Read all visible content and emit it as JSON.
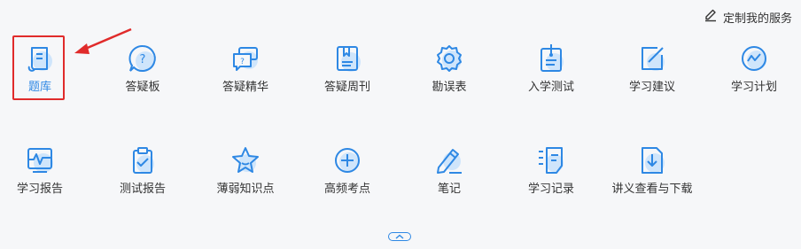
{
  "header": {
    "customize_label": "定制我的服务",
    "customize_icon": "pencil-icon"
  },
  "accent_color": "#2e88e4",
  "highlight_color": "#e02b2b",
  "row1": [
    {
      "label": "题库",
      "icon": "question-bank-icon",
      "active": true
    },
    {
      "label": "答疑板",
      "icon": "question-bubble-icon"
    },
    {
      "label": "答疑精华",
      "icon": "chat-bubbles-icon"
    },
    {
      "label": "答疑周刊",
      "icon": "bookmark-book-icon"
    },
    {
      "label": "勘误表",
      "icon": "gear-icon"
    },
    {
      "label": "入学测试",
      "icon": "clipboard-pin-icon"
    },
    {
      "label": "学习建议",
      "icon": "edit-square-icon"
    },
    {
      "label": "学习计划",
      "icon": "trend-circle-icon"
    }
  ],
  "row2": [
    {
      "label": "学习报告",
      "icon": "pulse-chart-icon"
    },
    {
      "label": "测试报告",
      "icon": "clipboard-check-icon"
    },
    {
      "label": "薄弱知识点",
      "icon": "star-icon"
    },
    {
      "label": "高频考点",
      "icon": "plus-circle-icon"
    },
    {
      "label": "笔记",
      "icon": "pen-icon"
    },
    {
      "label": "学习记录",
      "icon": "record-list-icon"
    },
    {
      "label": "讲义查看与下载",
      "icon": "download-doc-icon"
    }
  ],
  "collapse_icon": "chevron-up-icon"
}
